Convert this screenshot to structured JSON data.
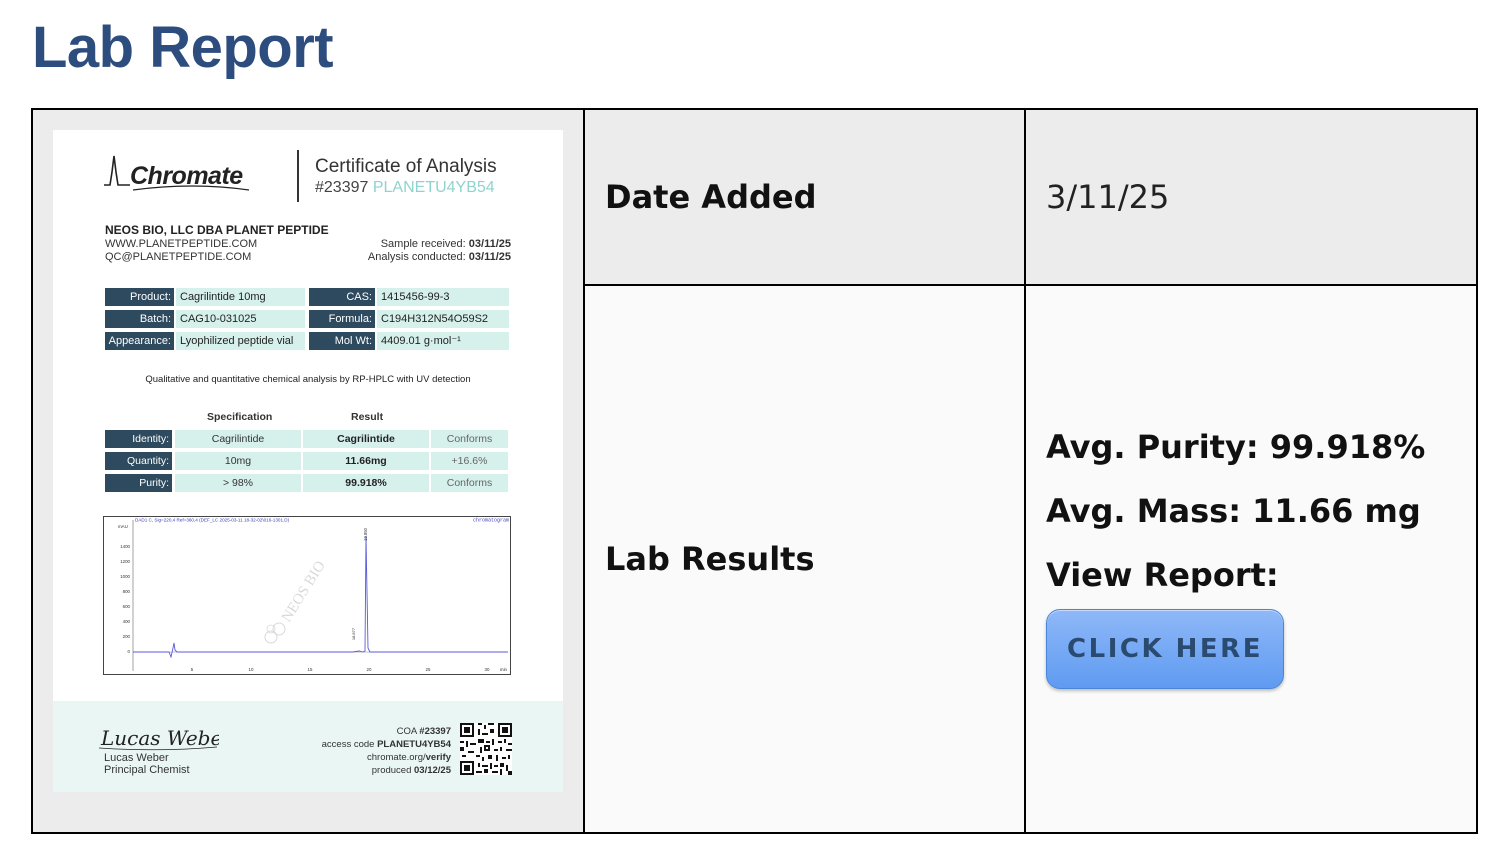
{
  "page": {
    "title": "Lab Report"
  },
  "table": {
    "date_label": "Date Added",
    "date_value": "3/11/25",
    "results_label": "Lab Results",
    "avg_purity": "Avg. Purity: 99.918%",
    "avg_mass": "Avg. Mass: 11.66 mg",
    "view_report": "View Report:",
    "button_label": "CLICK HERE"
  },
  "certificate": {
    "logo_text": "Chromate",
    "title": "Certificate of Analysis",
    "id_prefix": "#23397",
    "id_code": "PLANETU4YB54",
    "company": "NEOS BIO, LLC DBA PLANET PEPTIDE",
    "website": "WWW.PLANETPEPTIDE.COM",
    "email": "QC@PLANETPEPTIDE.COM",
    "sample_received_label": "Sample received:",
    "sample_received": "03/11/25",
    "analysis_conducted_label": "Analysis conducted:",
    "analysis_conducted": "03/11/25",
    "details": [
      {
        "key": "Product:",
        "value": "Cagrilintide 10mg"
      },
      {
        "key": "Batch:",
        "value": "CAG10-031025"
      },
      {
        "key": "Appearance:",
        "value": "Lyophilized peptide vial"
      },
      {
        "key": "CAS:",
        "value": "1415456-99-3"
      },
      {
        "key": "Formula:",
        "value": "C194H312N54O59S2"
      },
      {
        "key": "Mol Wt:",
        "value": "4409.01 g·mol⁻¹"
      }
    ],
    "method": "Qualitative and quantitative chemical analysis by RP-HPLC with UV detection",
    "spec_header": "Specification",
    "result_header": "Result",
    "results": [
      {
        "key": "Identity:",
        "spec": "Cagrilintide",
        "result": "Cagrilintide",
        "status": "Conforms"
      },
      {
        "key": "Quantity:",
        "spec": "10mg",
        "result": "11.66mg",
        "status": "+16.6%"
      },
      {
        "key": "Purity:",
        "spec": "> 98%",
        "result": "99.918%",
        "status": "Conforms"
      }
    ],
    "chromatogram": {
      "header": "DAD1 C, Sig=220,4 Ref=360,4 (DEF_LC 2025-03-11 18-32-02\\016-1301.D)",
      "tag": "chromatogram",
      "y_unit": "mAU",
      "y_ticks": [
        "1400",
        "1200",
        "1000",
        "800",
        "600",
        "400",
        "200",
        "0"
      ],
      "x_ticks": [
        "5",
        "10",
        "15",
        "20",
        "25",
        "30"
      ],
      "x_unit": "min",
      "peak_label": "19.850",
      "minor_peak_label": "18.877",
      "watermark": "NEOS BIO"
    },
    "signature": "Lucas Weber",
    "signer_name": "Lucas Weber",
    "signer_role": "Principal Chemist",
    "coa_label": "COA",
    "coa_number": "#23397",
    "access_label": "access code",
    "access_code": "PLANETU4YB54",
    "verify_domain": "chromate.org/",
    "verify_path": "verify",
    "produced_label": "produced",
    "produced_date": "03/12/25"
  }
}
